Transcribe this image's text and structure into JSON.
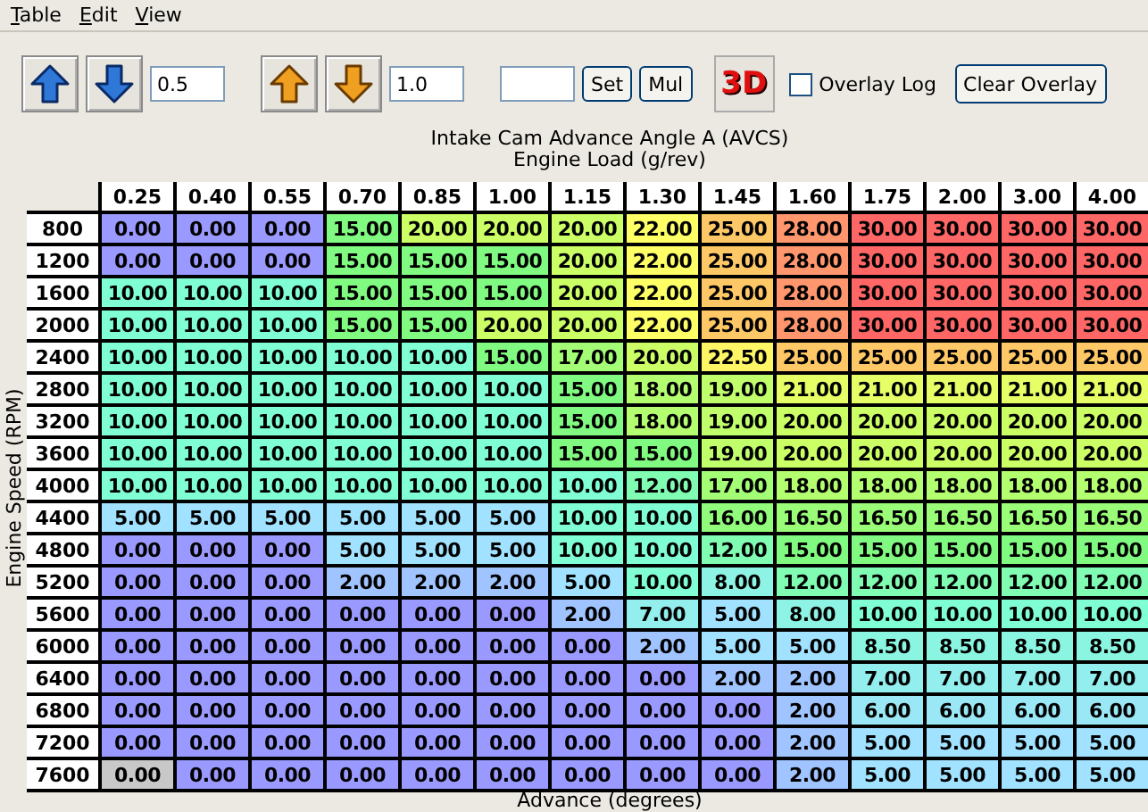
{
  "menu": [
    {
      "label": "Table"
    },
    {
      "label": "Edit"
    },
    {
      "label": "View"
    }
  ],
  "toolbar": {
    "coarse_step": "0.5",
    "fine_step": "1.0",
    "set_label": "Set",
    "mul_label": "Mul",
    "view_3d_label": "3D",
    "overlay_log": {
      "label": "Overlay Log",
      "checked": false
    },
    "clear_overlay_label": "Clear Overlay"
  },
  "table": {
    "title": "Intake Cam Advance Angle A (AVCS)",
    "x_axis_label": "Engine Load (g/rev)",
    "y_axis_label": "Engine Speed (RPM)",
    "value_label": "Advance (degrees)",
    "columns": [
      "0.25",
      "0.40",
      "0.55",
      "0.70",
      "0.85",
      "1.00",
      "1.15",
      "1.30",
      "1.45",
      "1.60",
      "1.75",
      "2.00",
      "3.00",
      "4.00"
    ],
    "rows": [
      {
        "label": "800",
        "cells": [
          {
            "value": "0.00",
            "selected": false
          },
          {
            "value": "0.00",
            "selected": false
          },
          {
            "value": "0.00",
            "selected": false
          },
          {
            "value": "15.00",
            "selected": false
          },
          {
            "value": "20.00",
            "selected": false
          },
          {
            "value": "20.00",
            "selected": false
          },
          {
            "value": "20.00",
            "selected": false
          },
          {
            "value": "22.00",
            "selected": false
          },
          {
            "value": "25.00",
            "selected": false
          },
          {
            "value": "28.00",
            "selected": false
          },
          {
            "value": "30.00",
            "selected": false
          },
          {
            "value": "30.00",
            "selected": false
          },
          {
            "value": "30.00",
            "selected": false
          },
          {
            "value": "30.00",
            "selected": false
          }
        ]
      },
      {
        "label": "1200",
        "cells": [
          {
            "value": "0.00",
            "selected": false
          },
          {
            "value": "0.00",
            "selected": false
          },
          {
            "value": "0.00",
            "selected": false
          },
          {
            "value": "15.00",
            "selected": false
          },
          {
            "value": "15.00",
            "selected": false
          },
          {
            "value": "15.00",
            "selected": false
          },
          {
            "value": "20.00",
            "selected": false
          },
          {
            "value": "22.00",
            "selected": false
          },
          {
            "value": "25.00",
            "selected": false
          },
          {
            "value": "28.00",
            "selected": false
          },
          {
            "value": "30.00",
            "selected": false
          },
          {
            "value": "30.00",
            "selected": false
          },
          {
            "value": "30.00",
            "selected": false
          },
          {
            "value": "30.00",
            "selected": false
          }
        ]
      },
      {
        "label": "1600",
        "cells": [
          {
            "value": "10.00",
            "selected": false
          },
          {
            "value": "10.00",
            "selected": false
          },
          {
            "value": "10.00",
            "selected": false
          },
          {
            "value": "15.00",
            "selected": false
          },
          {
            "value": "15.00",
            "selected": false
          },
          {
            "value": "15.00",
            "selected": false
          },
          {
            "value": "20.00",
            "selected": false
          },
          {
            "value": "22.00",
            "selected": false
          },
          {
            "value": "25.00",
            "selected": false
          },
          {
            "value": "28.00",
            "selected": false
          },
          {
            "value": "30.00",
            "selected": false
          },
          {
            "value": "30.00",
            "selected": false
          },
          {
            "value": "30.00",
            "selected": false
          },
          {
            "value": "30.00",
            "selected": false
          }
        ]
      },
      {
        "label": "2000",
        "cells": [
          {
            "value": "10.00",
            "selected": false
          },
          {
            "value": "10.00",
            "selected": false
          },
          {
            "value": "10.00",
            "selected": false
          },
          {
            "value": "15.00",
            "selected": false
          },
          {
            "value": "15.00",
            "selected": false
          },
          {
            "value": "20.00",
            "selected": false
          },
          {
            "value": "20.00",
            "selected": false
          },
          {
            "value": "22.00",
            "selected": false
          },
          {
            "value": "25.00",
            "selected": false
          },
          {
            "value": "28.00",
            "selected": false
          },
          {
            "value": "30.00",
            "selected": false
          },
          {
            "value": "30.00",
            "selected": false
          },
          {
            "value": "30.00",
            "selected": false
          },
          {
            "value": "30.00",
            "selected": false
          }
        ]
      },
      {
        "label": "2400",
        "cells": [
          {
            "value": "10.00",
            "selected": false
          },
          {
            "value": "10.00",
            "selected": false
          },
          {
            "value": "10.00",
            "selected": false
          },
          {
            "value": "10.00",
            "selected": false
          },
          {
            "value": "10.00",
            "selected": false
          },
          {
            "value": "15.00",
            "selected": false
          },
          {
            "value": "17.00",
            "selected": false
          },
          {
            "value": "20.00",
            "selected": false
          },
          {
            "value": "22.50",
            "selected": false
          },
          {
            "value": "25.00",
            "selected": false
          },
          {
            "value": "25.00",
            "selected": false
          },
          {
            "value": "25.00",
            "selected": false
          },
          {
            "value": "25.00",
            "selected": false
          },
          {
            "value": "25.00",
            "selected": false
          }
        ]
      },
      {
        "label": "2800",
        "cells": [
          {
            "value": "10.00",
            "selected": false
          },
          {
            "value": "10.00",
            "selected": false
          },
          {
            "value": "10.00",
            "selected": false
          },
          {
            "value": "10.00",
            "selected": false
          },
          {
            "value": "10.00",
            "selected": false
          },
          {
            "value": "10.00",
            "selected": false
          },
          {
            "value": "15.00",
            "selected": false
          },
          {
            "value": "18.00",
            "selected": false
          },
          {
            "value": "19.00",
            "selected": false
          },
          {
            "value": "21.00",
            "selected": false
          },
          {
            "value": "21.00",
            "selected": false
          },
          {
            "value": "21.00",
            "selected": false
          },
          {
            "value": "21.00",
            "selected": false
          },
          {
            "value": "21.00",
            "selected": false
          }
        ]
      },
      {
        "label": "3200",
        "cells": [
          {
            "value": "10.00",
            "selected": false
          },
          {
            "value": "10.00",
            "selected": false
          },
          {
            "value": "10.00",
            "selected": false
          },
          {
            "value": "10.00",
            "selected": false
          },
          {
            "value": "10.00",
            "selected": false
          },
          {
            "value": "10.00",
            "selected": false
          },
          {
            "value": "15.00",
            "selected": false
          },
          {
            "value": "18.00",
            "selected": false
          },
          {
            "value": "19.00",
            "selected": false
          },
          {
            "value": "20.00",
            "selected": false
          },
          {
            "value": "20.00",
            "selected": false
          },
          {
            "value": "20.00",
            "selected": false
          },
          {
            "value": "20.00",
            "selected": false
          },
          {
            "value": "20.00",
            "selected": false
          }
        ]
      },
      {
        "label": "3600",
        "cells": [
          {
            "value": "10.00",
            "selected": false
          },
          {
            "value": "10.00",
            "selected": false
          },
          {
            "value": "10.00",
            "selected": false
          },
          {
            "value": "10.00",
            "selected": false
          },
          {
            "value": "10.00",
            "selected": false
          },
          {
            "value": "10.00",
            "selected": false
          },
          {
            "value": "15.00",
            "selected": false
          },
          {
            "value": "15.00",
            "selected": false
          },
          {
            "value": "19.00",
            "selected": false
          },
          {
            "value": "20.00",
            "selected": false
          },
          {
            "value": "20.00",
            "selected": false
          },
          {
            "value": "20.00",
            "selected": false
          },
          {
            "value": "20.00",
            "selected": false
          },
          {
            "value": "20.00",
            "selected": false
          }
        ]
      },
      {
        "label": "4000",
        "cells": [
          {
            "value": "10.00",
            "selected": false
          },
          {
            "value": "10.00",
            "selected": false
          },
          {
            "value": "10.00",
            "selected": false
          },
          {
            "value": "10.00",
            "selected": false
          },
          {
            "value": "10.00",
            "selected": false
          },
          {
            "value": "10.00",
            "selected": false
          },
          {
            "value": "10.00",
            "selected": false
          },
          {
            "value": "12.00",
            "selected": false
          },
          {
            "value": "17.00",
            "selected": false
          },
          {
            "value": "18.00",
            "selected": false
          },
          {
            "value": "18.00",
            "selected": false
          },
          {
            "value": "18.00",
            "selected": false
          },
          {
            "value": "18.00",
            "selected": false
          },
          {
            "value": "18.00",
            "selected": false
          }
        ]
      },
      {
        "label": "4400",
        "cells": [
          {
            "value": "5.00",
            "selected": false
          },
          {
            "value": "5.00",
            "selected": false
          },
          {
            "value": "5.00",
            "selected": false
          },
          {
            "value": "5.00",
            "selected": false
          },
          {
            "value": "5.00",
            "selected": false
          },
          {
            "value": "5.00",
            "selected": false
          },
          {
            "value": "10.00",
            "selected": false
          },
          {
            "value": "10.00",
            "selected": false
          },
          {
            "value": "16.00",
            "selected": false
          },
          {
            "value": "16.50",
            "selected": false
          },
          {
            "value": "16.50",
            "selected": false
          },
          {
            "value": "16.50",
            "selected": false
          },
          {
            "value": "16.50",
            "selected": false
          },
          {
            "value": "16.50",
            "selected": false
          }
        ]
      },
      {
        "label": "4800",
        "cells": [
          {
            "value": "0.00",
            "selected": false
          },
          {
            "value": "0.00",
            "selected": false
          },
          {
            "value": "0.00",
            "selected": false
          },
          {
            "value": "5.00",
            "selected": false
          },
          {
            "value": "5.00",
            "selected": false
          },
          {
            "value": "5.00",
            "selected": false
          },
          {
            "value": "10.00",
            "selected": false
          },
          {
            "value": "10.00",
            "selected": false
          },
          {
            "value": "12.00",
            "selected": false
          },
          {
            "value": "15.00",
            "selected": false
          },
          {
            "value": "15.00",
            "selected": false
          },
          {
            "value": "15.00",
            "selected": false
          },
          {
            "value": "15.00",
            "selected": false
          },
          {
            "value": "15.00",
            "selected": false
          }
        ]
      },
      {
        "label": "5200",
        "cells": [
          {
            "value": "0.00",
            "selected": false
          },
          {
            "value": "0.00",
            "selected": false
          },
          {
            "value": "0.00",
            "selected": false
          },
          {
            "value": "2.00",
            "selected": false
          },
          {
            "value": "2.00",
            "selected": false
          },
          {
            "value": "2.00",
            "selected": false
          },
          {
            "value": "5.00",
            "selected": false
          },
          {
            "value": "10.00",
            "selected": false
          },
          {
            "value": "8.00",
            "selected": false
          },
          {
            "value": "12.00",
            "selected": false
          },
          {
            "value": "12.00",
            "selected": false
          },
          {
            "value": "12.00",
            "selected": false
          },
          {
            "value": "12.00",
            "selected": false
          },
          {
            "value": "12.00",
            "selected": false
          }
        ]
      },
      {
        "label": "5600",
        "cells": [
          {
            "value": "0.00",
            "selected": false
          },
          {
            "value": "0.00",
            "selected": false
          },
          {
            "value": "0.00",
            "selected": false
          },
          {
            "value": "0.00",
            "selected": false
          },
          {
            "value": "0.00",
            "selected": false
          },
          {
            "value": "0.00",
            "selected": false
          },
          {
            "value": "2.00",
            "selected": false
          },
          {
            "value": "7.00",
            "selected": false
          },
          {
            "value": "5.00",
            "selected": false
          },
          {
            "value": "8.00",
            "selected": false
          },
          {
            "value": "10.00",
            "selected": false
          },
          {
            "value": "10.00",
            "selected": false
          },
          {
            "value": "10.00",
            "selected": false
          },
          {
            "value": "10.00",
            "selected": false
          }
        ]
      },
      {
        "label": "6000",
        "cells": [
          {
            "value": "0.00",
            "selected": false
          },
          {
            "value": "0.00",
            "selected": false
          },
          {
            "value": "0.00",
            "selected": false
          },
          {
            "value": "0.00",
            "selected": false
          },
          {
            "value": "0.00",
            "selected": false
          },
          {
            "value": "0.00",
            "selected": false
          },
          {
            "value": "0.00",
            "selected": false
          },
          {
            "value": "2.00",
            "selected": false
          },
          {
            "value": "5.00",
            "selected": false
          },
          {
            "value": "5.00",
            "selected": false
          },
          {
            "value": "8.50",
            "selected": false
          },
          {
            "value": "8.50",
            "selected": false
          },
          {
            "value": "8.50",
            "selected": false
          },
          {
            "value": "8.50",
            "selected": false
          }
        ]
      },
      {
        "label": "6400",
        "cells": [
          {
            "value": "0.00",
            "selected": false
          },
          {
            "value": "0.00",
            "selected": false
          },
          {
            "value": "0.00",
            "selected": false
          },
          {
            "value": "0.00",
            "selected": false
          },
          {
            "value": "0.00",
            "selected": false
          },
          {
            "value": "0.00",
            "selected": false
          },
          {
            "value": "0.00",
            "selected": false
          },
          {
            "value": "0.00",
            "selected": false
          },
          {
            "value": "2.00",
            "selected": false
          },
          {
            "value": "2.00",
            "selected": false
          },
          {
            "value": "7.00",
            "selected": false
          },
          {
            "value": "7.00",
            "selected": false
          },
          {
            "value": "7.00",
            "selected": false
          },
          {
            "value": "7.00",
            "selected": false
          }
        ]
      },
      {
        "label": "6800",
        "cells": [
          {
            "value": "0.00",
            "selected": false
          },
          {
            "value": "0.00",
            "selected": false
          },
          {
            "value": "0.00",
            "selected": false
          },
          {
            "value": "0.00",
            "selected": false
          },
          {
            "value": "0.00",
            "selected": false
          },
          {
            "value": "0.00",
            "selected": false
          },
          {
            "value": "0.00",
            "selected": false
          },
          {
            "value": "0.00",
            "selected": false
          },
          {
            "value": "0.00",
            "selected": false
          },
          {
            "value": "2.00",
            "selected": false
          },
          {
            "value": "6.00",
            "selected": false
          },
          {
            "value": "6.00",
            "selected": false
          },
          {
            "value": "6.00",
            "selected": false
          },
          {
            "value": "6.00",
            "selected": false
          }
        ]
      },
      {
        "label": "7200",
        "cells": [
          {
            "value": "0.00",
            "selected": false
          },
          {
            "value": "0.00",
            "selected": false
          },
          {
            "value": "0.00",
            "selected": false
          },
          {
            "value": "0.00",
            "selected": false
          },
          {
            "value": "0.00",
            "selected": false
          },
          {
            "value": "0.00",
            "selected": false
          },
          {
            "value": "0.00",
            "selected": false
          },
          {
            "value": "0.00",
            "selected": false
          },
          {
            "value": "0.00",
            "selected": false
          },
          {
            "value": "2.00",
            "selected": false
          },
          {
            "value": "5.00",
            "selected": false
          },
          {
            "value": "5.00",
            "selected": false
          },
          {
            "value": "5.00",
            "selected": false
          },
          {
            "value": "5.00",
            "selected": false
          }
        ]
      },
      {
        "label": "7600",
        "cells": [
          {
            "value": "0.00",
            "selected": true
          },
          {
            "value": "0.00",
            "selected": false
          },
          {
            "value": "0.00",
            "selected": false
          },
          {
            "value": "0.00",
            "selected": false
          },
          {
            "value": "0.00",
            "selected": false
          },
          {
            "value": "0.00",
            "selected": false
          },
          {
            "value": "0.00",
            "selected": false
          },
          {
            "value": "0.00",
            "selected": false
          },
          {
            "value": "0.00",
            "selected": false
          },
          {
            "value": "2.00",
            "selected": false
          },
          {
            "value": "5.00",
            "selected": false
          },
          {
            "value": "5.00",
            "selected": false
          },
          {
            "value": "5.00",
            "selected": false
          },
          {
            "value": "5.00",
            "selected": false
          }
        ]
      }
    ]
  }
}
